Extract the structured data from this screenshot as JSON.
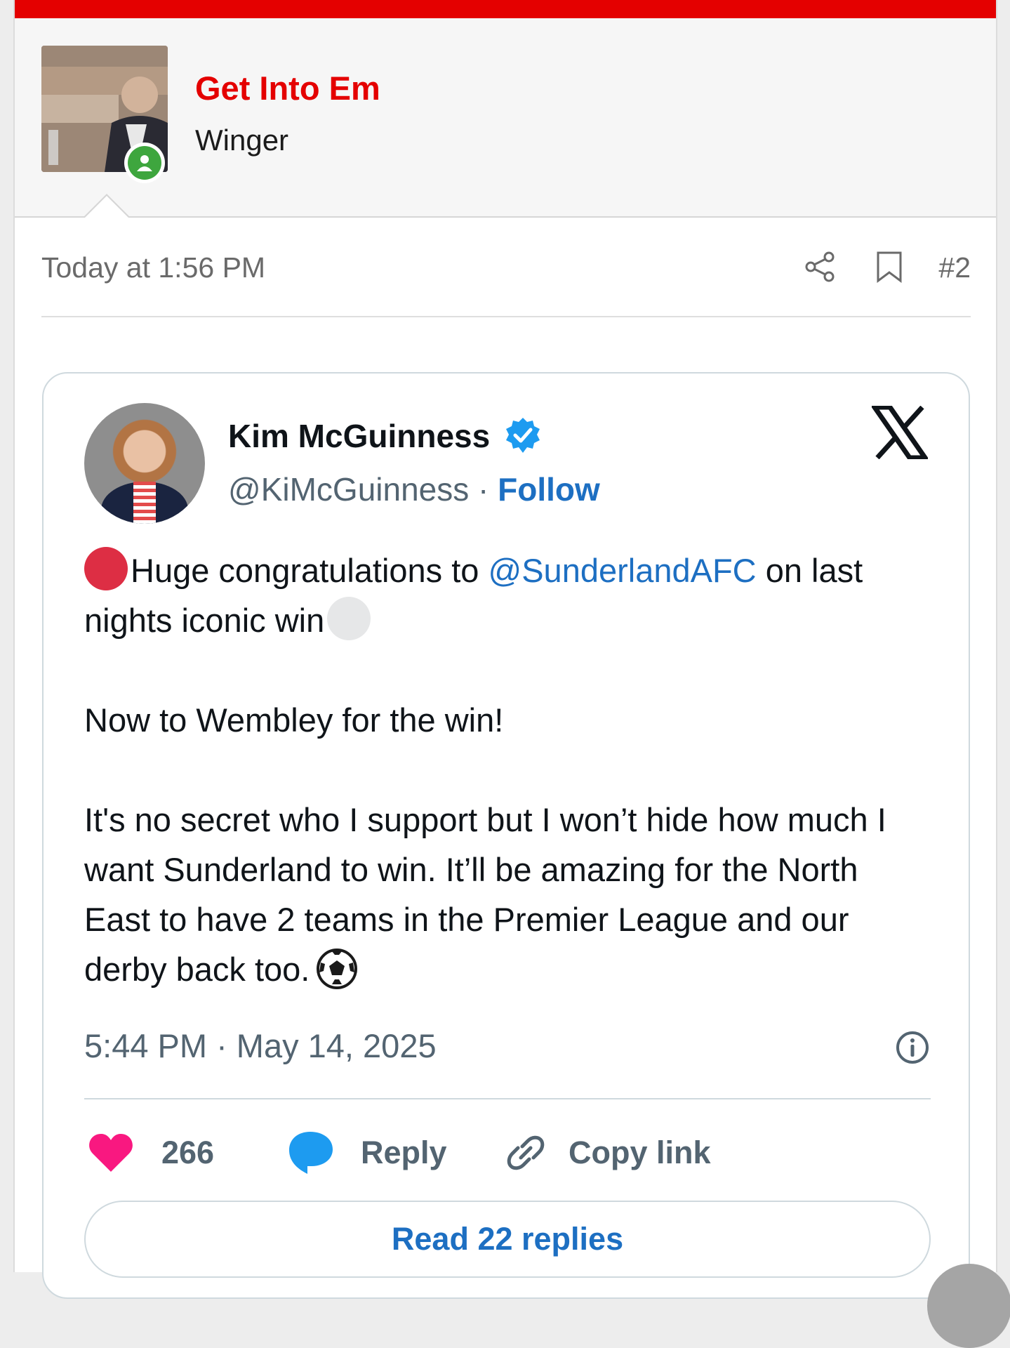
{
  "post": {
    "username": "Get Into Em",
    "user_title": "Winger",
    "timestamp": "Today at 1:56 PM",
    "number": "#2"
  },
  "tweet": {
    "author_name": "Kim McGuinness",
    "handle": "@KiMcGuinness",
    "separator": "·",
    "follow_label": "Follow",
    "text": {
      "line1_before": "Huge congratulations to ",
      "mention": "@SunderlandAFC",
      "line1_after": " on last nights iconic win",
      "para2": "Now to Wembley for the win!",
      "para3": "It's no secret who I support but I won’t hide how much I want Sunderland to win. It’ll be amazing for the North East to have 2 teams in the Premier League and our derby back too."
    },
    "date": "5:44 PM · May 14, 2025",
    "likes": "266",
    "reply_label": "Reply",
    "copy_label": "Copy link",
    "read_replies_label": "Read 22 replies"
  },
  "colors": {
    "brand_red": "#e40000",
    "link_blue": "#1d6fc2",
    "like_pink": "#f91880",
    "reply_blue": "#1d9bf0",
    "verified_blue": "#1d9bf0",
    "online_green": "#3ea63e"
  },
  "icons": [
    "online-status-icon",
    "share-icon",
    "bookmark-icon",
    "verified-badge-icon",
    "x-logo-icon",
    "red-circle-emoji",
    "white-circle-emoji",
    "soccer-ball-emoji",
    "info-icon",
    "heart-icon",
    "reply-bubble-icon",
    "link-icon"
  ]
}
